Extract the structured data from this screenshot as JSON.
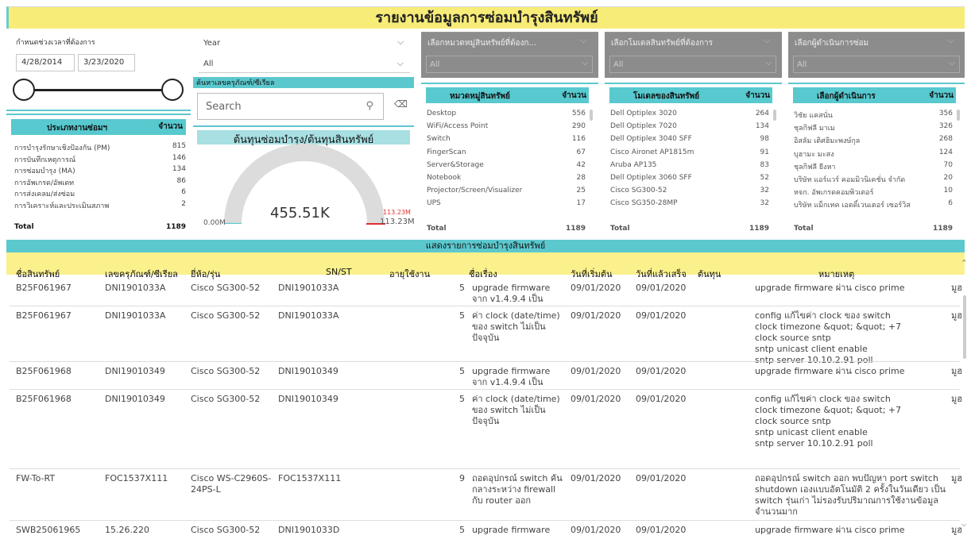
{
  "title": "รายงานข้อมูลการซ่อมบำรุงสินทรัพย์",
  "date_filter": {
    "label": "กำหนดช่วงเวลาที่ต้องการ",
    "start": "4/28/2014",
    "end": "3/23/2020"
  },
  "year_filter": {
    "label": "Year",
    "value": "All"
  },
  "search_section": {
    "label": "ค้นหาเลขครุภัณฑ์/ซีเรียล",
    "placeholder": "Search"
  },
  "gauge": {
    "title": "ต้นทุนซ่อมบำรุง/ต้นทุนสินทรัพย์",
    "value": "455.51K",
    "min": "0.00M",
    "max": "113.23M",
    "target": "113.23M",
    "fill": 0.004
  },
  "maintenance_types": {
    "header": [
      "ประเภทงานซ่อมฯ",
      "จำนวน"
    ],
    "rows": [
      [
        "การบำรุงรักษาเชิงป้องกัน (PM)",
        "815"
      ],
      [
        "การบันทึกเหตุการณ์",
        "146"
      ],
      [
        "การซ่อมบำรุง (MA)",
        "134"
      ],
      [
        "การอัพเกรด/อัพเดท",
        "86"
      ],
      [
        "การส่งเคลม/ส่งซ่อม",
        "6"
      ],
      [
        "การวิเคราะห์และประเมินสภาพ",
        "2"
      ]
    ],
    "total": [
      "Total",
      "1189"
    ]
  },
  "filters": [
    {
      "label": "เลือกหมวดหมู่สินทรัพย์ที่ต้องก...",
      "value": "All"
    },
    {
      "label": "เลือกโมเดลสินทรัพย์ที่ต้องการ",
      "value": "All"
    },
    {
      "label": "เลือกผู้ดำเนินการซ่อม",
      "value": "All"
    }
  ],
  "categories": {
    "header": [
      "หมวดหมู่สินทรัพย์",
      "จำนวน"
    ],
    "rows": [
      [
        "Desktop",
        "556"
      ],
      [
        "WiFi/Access Point",
        "290"
      ],
      [
        "Switch",
        "116"
      ],
      [
        "FingerScan",
        "67"
      ],
      [
        "Server&Storage",
        "42"
      ],
      [
        "Notebook",
        "28"
      ],
      [
        "Projector/Screen/Visualizer",
        "25"
      ],
      [
        "UPS",
        "17"
      ]
    ],
    "total": [
      "Total",
      "1189"
    ]
  },
  "models": {
    "header": [
      "โมเดลของสินทรัพย์",
      "จำนวน"
    ],
    "rows": [
      [
        "Dell Optiplex 3020",
        "264"
      ],
      [
        "Dell Optiplex 7020",
        "134"
      ],
      [
        "Dell Optiplex 3040 SFF",
        "98"
      ],
      [
        "Cisco Aironet AP1815m",
        "91"
      ],
      [
        "Aruba AP135",
        "83"
      ],
      [
        "Dell Optiplex 3060 SFF",
        "52"
      ],
      [
        "Cisco SG300-52",
        "32"
      ],
      [
        "Cisco SG350-28MP",
        "32"
      ]
    ],
    "total": [
      "Total",
      "1189"
    ]
  },
  "operators": {
    "header": [
      "เลือกผู้ดำเนินการ",
      "จำนวน"
    ],
    "rows": [
      [
        "วิชัย แคสนั่น",
        "356"
      ],
      [
        "ชุลกิฟลี มาเม",
        "326"
      ],
      [
        "อิสลัม เติศฮิมะพงษ์กุล",
        "268"
      ],
      [
        "บุฮามะ มะสง",
        "124"
      ],
      [
        "ชุลกิฟลี ยีงหา",
        "70"
      ],
      [
        "บริษัท แอร์แวร์ คอมมิวนิเคชั่น จำกัด",
        "20"
      ],
      [
        "หจก. อัพเกรดคอมพิวเตอร์",
        "10"
      ],
      [
        "บริษัท แม็กเทค เอดดิ์เวนเตอร์ เซอร์วิส",
        "6"
      ]
    ],
    "total": [
      "Total",
      "1189"
    ]
  },
  "main_table": {
    "title": "แสดงรายการซ่อมบำรุงสินทรัพย์",
    "columns": [
      "ชื่อสินทรัพย์",
      "เลขครุภัณฑ์/ซีเรียล",
      "ยี่ห้อ/รุ่น",
      "SN/ST",
      "อายุใช้งาน",
      "ชื่อเรื่อง",
      "วันที่เริ่มต้น",
      "วันที่แล้วเสร็จ",
      "ต้นทุน",
      "หมายเหตุ"
    ],
    "rows": [
      [
        "B25F061967",
        "DNI1901033A",
        "Cisco SG300-52",
        "DNI1901033A",
        "5",
        "upgrade firmware จาก v1.4.9.4 เป็น v1.4.11.2",
        "09/01/2020",
        "09/01/2020",
        "",
        "upgrade firmware ผ่าน cisco prime",
        "มูฮ"
      ],
      [
        "B25F061967",
        "DNI1901033A",
        "Cisco SG300-52",
        "DNI1901033A",
        "5",
        "ค่า clock (date/time) ของ switch ไม่เป็นปัจจุบัน",
        "09/01/2020",
        "09/01/2020",
        "",
        "config แก้ไขค่า clock ของ switch\nclock timezone &quot; &quot; +7\nclock source sntp\nsntp unicast client enable\nsntp server 10.10.2.91 poll",
        "มูฮ"
      ],
      [
        "B25F061968",
        "DNI19010349",
        "Cisco SG300-52",
        "DNI19010349",
        "5",
        "upgrade firmware จาก v1.4.9.4 เป็น v1.4.11.2",
        "09/01/2020",
        "09/01/2020",
        "",
        "upgrade firmware ผ่าน cisco prime",
        "มูฮ"
      ],
      [
        "B25F061968",
        "DNI19010349",
        "Cisco SG300-52",
        "DNI19010349",
        "5",
        "ค่า clock (date/time) ของ switch ไม่เป็นปัจจุบัน",
        "09/01/2020",
        "09/01/2020",
        "",
        "config แก้ไขค่า clock ของ switch\nclock timezone &quot; &quot; +7\nclock source sntp\nsntp unicast client enable\nsntp server 10.10.2.91 poll",
        "มูฮ"
      ],
      [
        "FW-To-RT",
        "FOC1537X111",
        "Cisco WS-C2960S-24PS-L",
        "FOC1537X111",
        "9",
        "ถอดอุปกรณ์ switch คั่นกลางระหว่าง firewall กับ router ออก",
        "09/01/2020",
        "09/01/2020",
        "",
        "ถอดอุปกรณ์ switch ออก พบปัญหา port switch shutdown เองแบบอัตโนมัติ 2 ครั้งในวันเดียว เป็น switch รุ่นเก่า ไม่รองรับปริมาณการใช้งานข้อมูลจำนวนมาก",
        "มูฮ"
      ],
      [
        "SWB25061965",
        "15.26.220",
        "Cisco SG300-52",
        "DNI1901033D",
        "5",
        "upgrade firmware จาก",
        "09/01/2020",
        "09/01/2020",
        "",
        "upgrade firmware ผ่าน cisco prime",
        "มูฮ"
      ]
    ]
  }
}
